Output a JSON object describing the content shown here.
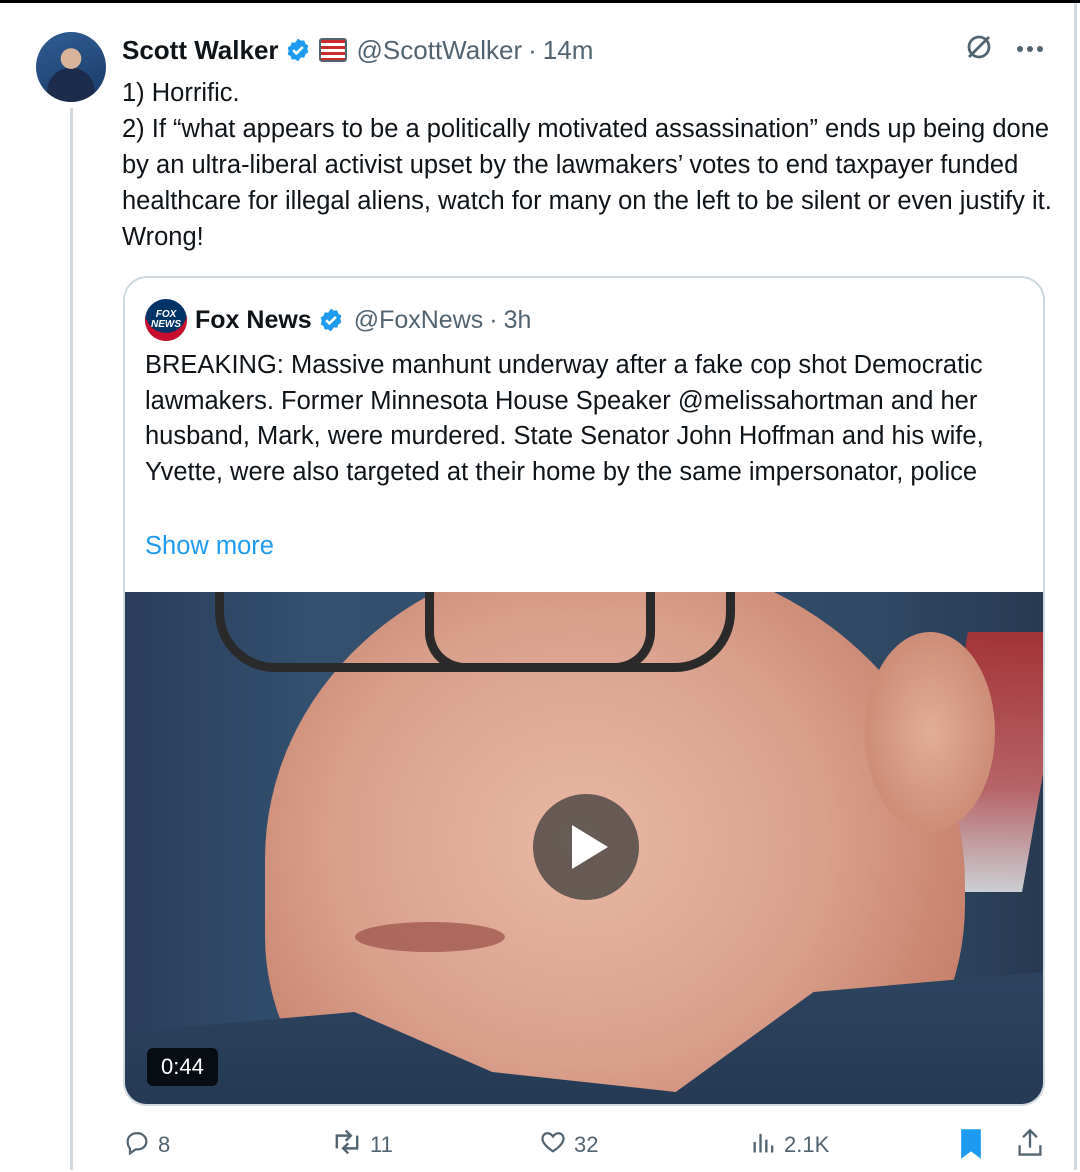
{
  "tweet": {
    "author_name": "Scott Walker",
    "author_handle": "@ScottWalker",
    "separator": "·",
    "time": "14m",
    "line1": "1) Horrific.",
    "line2": "2) If “what appears to be a politically motivated assassination” ends up being done by an ultra-liberal activist upset by the lawmakers’ votes to end taxpayer funded healthcare for illegal aliens, watch for many on the left to be silent or even justify it. Wrong!"
  },
  "quote": {
    "author_name": "Fox News",
    "author_handle": "@FoxNews",
    "separator": "·",
    "time": "3h",
    "logo_line1": "FOX",
    "logo_line2": "NEWS",
    "text": "BREAKING: Massive manhunt underway after a fake cop shot Democratic lawmakers. Former Minnesota House Speaker @melissahortman and her husband, Mark, were murdered. State Senator John Hoffman and his wife, Yvette, were also targeted at their home by the same impersonator, police",
    "show_more": "Show more",
    "video_duration": "0:44"
  },
  "actions": {
    "replies": "8",
    "reposts": "11",
    "likes": "32",
    "views": "2.1K"
  },
  "colors": {
    "accent": "#1d9bf0",
    "text": "#0f1419",
    "muted": "#536471",
    "border": "#cfd9de"
  },
  "icons": [
    "verified-badge-icon",
    "flag-badge-icon",
    "grok-icon",
    "more-icon",
    "play-icon",
    "reply-icon",
    "repost-icon",
    "like-icon",
    "views-icon",
    "bookmark-icon",
    "share-icon"
  ]
}
